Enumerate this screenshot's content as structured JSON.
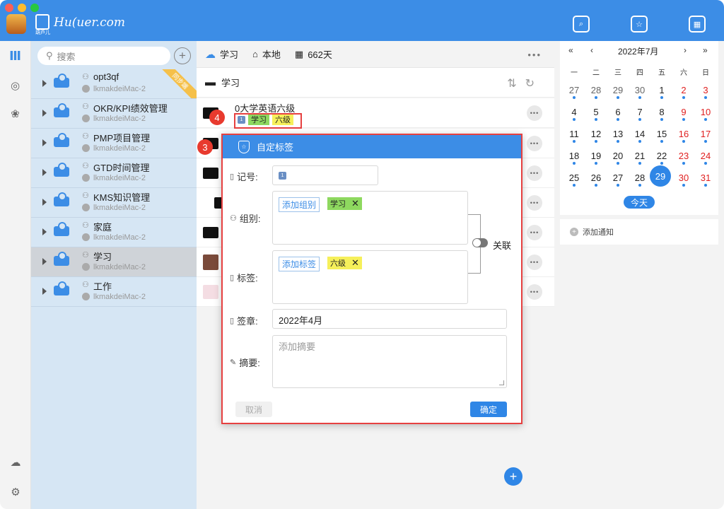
{
  "app": {
    "logo_text": "Hu(uer.com",
    "logo_sub": "葫芦儿"
  },
  "colors": {
    "accent": "#3c8de6",
    "highlight": "#e64040",
    "tag_green": "#8ed85f",
    "tag_yellow": "#f6f05a"
  },
  "sidebar": {
    "search_placeholder": "搜索",
    "ribbon": "同步端",
    "items": [
      {
        "name": "opt3qf",
        "host": "lkmakdeiMac-2"
      },
      {
        "name": "OKR/KPI绩效管理",
        "host": "lkmakdeiMac-2"
      },
      {
        "name": "PMP项目管理",
        "host": "lkmakdeiMac-2"
      },
      {
        "name": "GTD时间管理",
        "host": "lkmakdeiMac-2"
      },
      {
        "name": "KMS知识管理",
        "host": "lkmakdeiMac-2"
      },
      {
        "name": "家庭",
        "host": "lkmakdeiMac-2"
      },
      {
        "name": "学习",
        "host": "lkmakdeiMac-2"
      },
      {
        "name": "工作",
        "host": "lkmakdeiMac-2"
      }
    ]
  },
  "middle": {
    "header": {
      "db": "学习",
      "location": "本地",
      "days": "662天"
    },
    "path": "学习",
    "first_row": {
      "title": "0大学英语六级",
      "num": "1",
      "tag1": "学习",
      "tag2": "六级"
    },
    "more": "•••"
  },
  "steps": {
    "s3": "3",
    "s4": "4"
  },
  "dialog": {
    "title": "自定标签",
    "record_label": "记号:",
    "record_value": "1",
    "group_label": "组别:",
    "group_add": "添加组别",
    "group_chip": "学习",
    "tag_label": "标签:",
    "tag_add": "添加标签",
    "tag_chip": "六级",
    "link_label": "关联",
    "seal_label": "签章:",
    "seal_value": "2022年4月",
    "summary_label": "摘要:",
    "summary_placeholder": "添加摘要",
    "cancel": "取消",
    "ok": "确定"
  },
  "calendar": {
    "prev_year": "«",
    "prev_month": "‹",
    "title": "2022年7月",
    "next_month": "›",
    "next_year": "»",
    "weekdays": [
      "一",
      "二",
      "三",
      "四",
      "五",
      "六",
      "日"
    ],
    "weeks": [
      [
        "27",
        "28",
        "29",
        "30",
        "1",
        "2",
        "3"
      ],
      [
        "4",
        "5",
        "6",
        "7",
        "8",
        "9",
        "10"
      ],
      [
        "11",
        "12",
        "13",
        "14",
        "15",
        "16",
        "17"
      ],
      [
        "18",
        "19",
        "20",
        "21",
        "22",
        "23",
        "24"
      ],
      [
        "25",
        "26",
        "27",
        "28",
        "29",
        "30",
        "31"
      ]
    ],
    "today_button": "今天",
    "add_notice": "添加通知"
  }
}
